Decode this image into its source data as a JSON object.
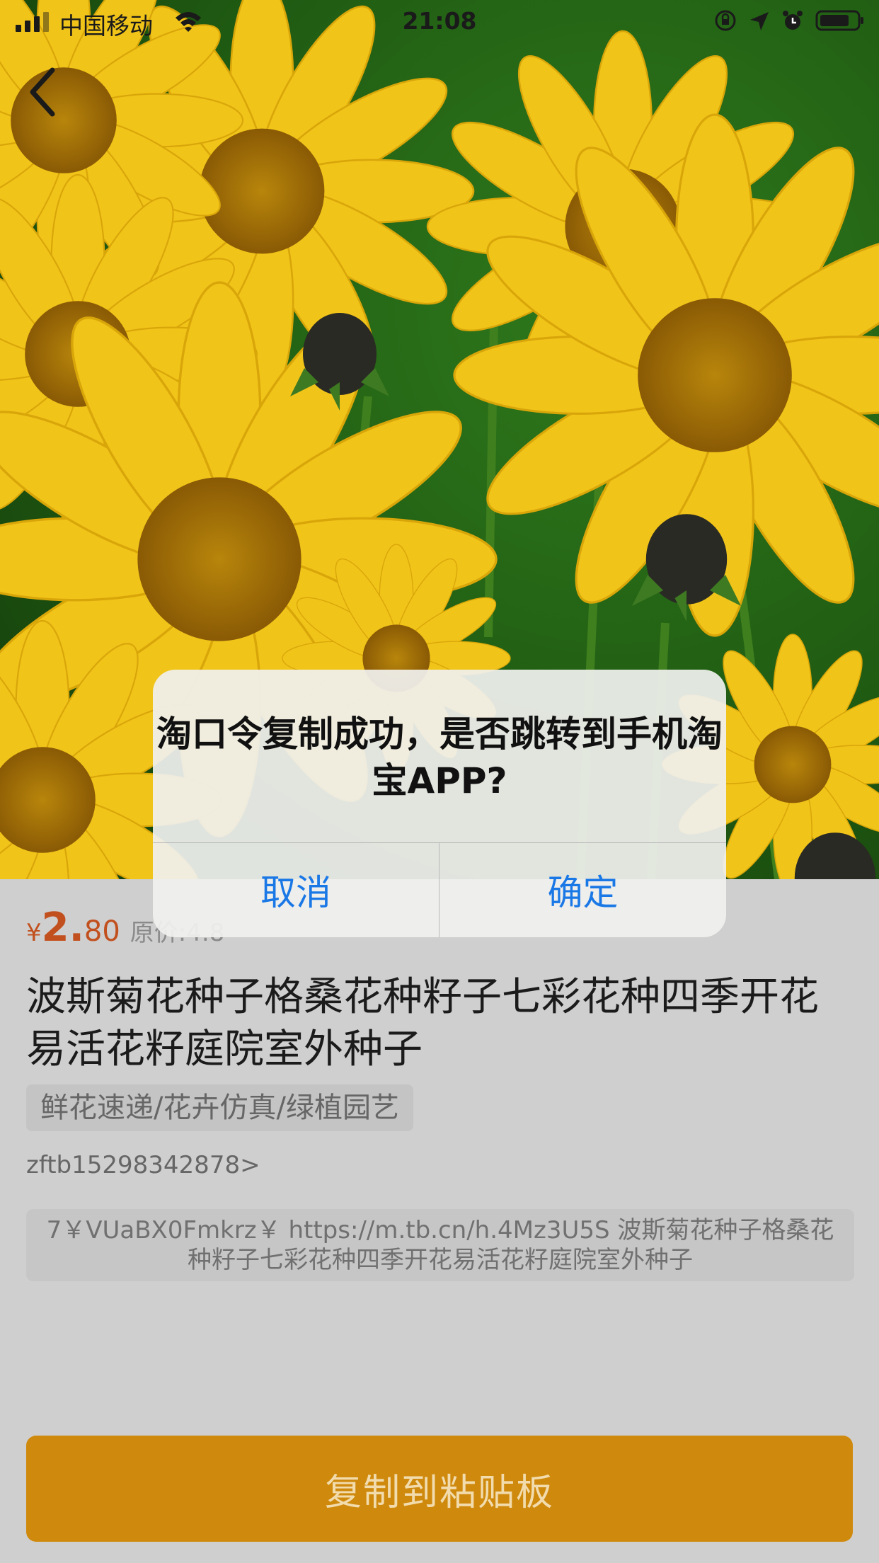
{
  "status_bar": {
    "carrier": "中国移动",
    "time": "21:08"
  },
  "product": {
    "price_currency": "¥",
    "price_integer": "2.",
    "price_decimal": "80",
    "original_price": "原价:4.8",
    "title": "波斯菊花种子格桑花种籽子七彩花种四季开花易活花籽庭院室外种子",
    "category": "鲜花速递/花卉仿真/绿植园艺",
    "user_id": "zftb15298342878>",
    "token_text": "7￥VUaBX0Fmkrz￥ https://m.tb.cn/h.4Mz3U5S 波斯菊花种子格桑花种籽子七彩花种四季开花易活花籽庭院室外种子"
  },
  "copy_button": {
    "label": "复制到粘贴板"
  },
  "dialog": {
    "message": "淘口令复制成功，是否跳转到手机淘宝APP?",
    "cancel_label": "取消",
    "confirm_label": "确定"
  },
  "colors": {
    "accent_price": "#c2501e",
    "button_orange": "#cf8a0e",
    "dialog_button_blue": "#1a78e6"
  }
}
